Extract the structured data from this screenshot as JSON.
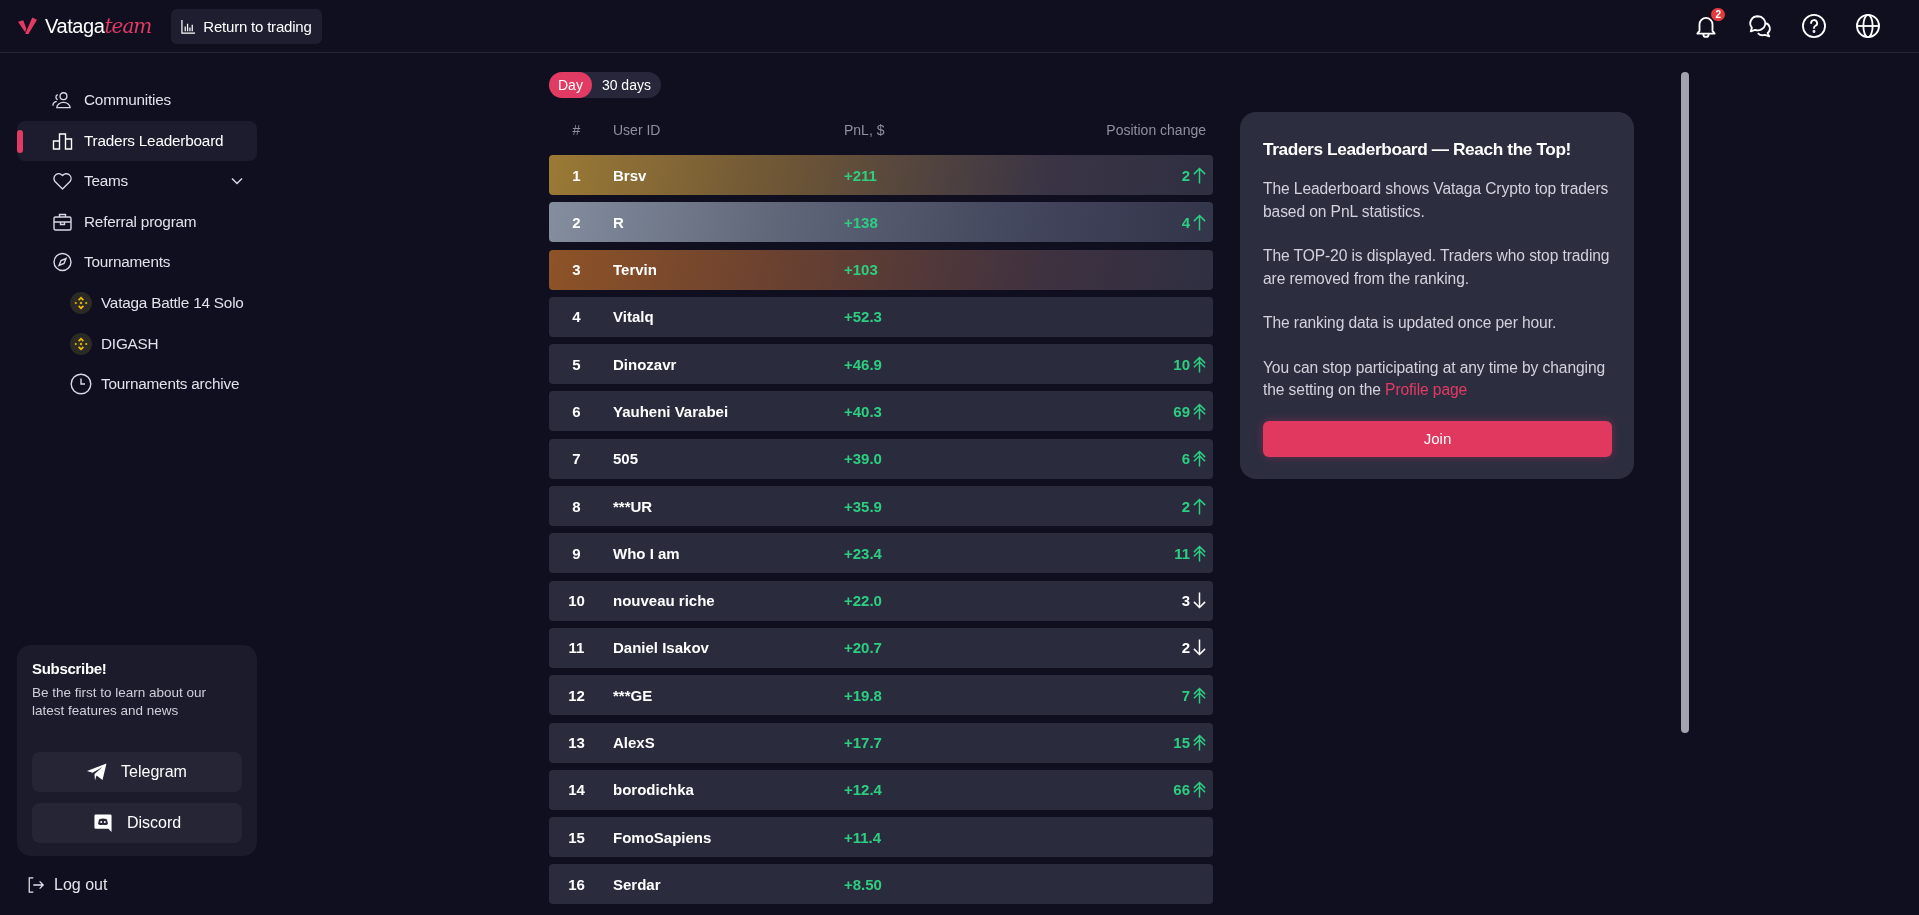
{
  "header": {
    "logo": {
      "name": "Vataga",
      "suffix": "team"
    },
    "return_button": "Return to trading",
    "notifications": {
      "count": "2"
    }
  },
  "sidebar": {
    "items": [
      {
        "label": "Communities",
        "kind": "link",
        "selected": false
      },
      {
        "label": "Traders Leaderboard",
        "kind": "link",
        "selected": true
      },
      {
        "label": "Teams",
        "kind": "dropdown",
        "selected": false,
        "expanded": false
      },
      {
        "label": "Referral program",
        "kind": "link",
        "selected": false
      },
      {
        "label": "Tournaments",
        "kind": "link",
        "selected": false,
        "children": [
          {
            "label": "Vataga Battle 14 Solo",
            "selected": false
          },
          {
            "label": "DIGASH",
            "selected": false
          },
          {
            "label": "Tournaments archive",
            "selected": false
          }
        ]
      }
    ],
    "subscribe": {
      "title": "Subscribe!",
      "text": "Be the first to learn about our latest features and news",
      "buttons": [
        "Telegram",
        "Discord"
      ]
    },
    "logout": "Log out"
  },
  "periods": [
    {
      "label": "Day",
      "selected": true
    },
    {
      "label": "30 days",
      "selected": false
    }
  ],
  "table": {
    "columns": [
      "#",
      "User ID",
      "PnL, $",
      "Position change"
    ],
    "rows": [
      {
        "rank": "1",
        "user": "Brsv",
        "pnl": "+211",
        "change": {
          "value": "2",
          "kind": "up"
        },
        "kind": "gold"
      },
      {
        "rank": "2",
        "user": "R",
        "pnl": "+138",
        "change": {
          "value": "4",
          "kind": "up"
        },
        "kind": "silver"
      },
      {
        "rank": "3",
        "user": "Tervin",
        "pnl": "+103",
        "kind": "bronze"
      },
      {
        "rank": "4",
        "user": "Vitalq",
        "pnl": "+52.3",
        "kind": "plain"
      },
      {
        "rank": "5",
        "user": "Dinozavr",
        "pnl": "+46.9",
        "change": {
          "value": "10",
          "kind": "surge"
        },
        "kind": "plain"
      },
      {
        "rank": "6",
        "user": "Yauheni Varabei",
        "pnl": "+40.3",
        "change": {
          "value": "69",
          "kind": "surge"
        },
        "kind": "plain"
      },
      {
        "rank": "7",
        "user": "505",
        "pnl": "+39.0",
        "change": {
          "value": "6",
          "kind": "surge"
        },
        "kind": "plain"
      },
      {
        "rank": "8",
        "user": "***UR",
        "pnl": "+35.9",
        "change": {
          "value": "2",
          "kind": "up"
        },
        "kind": "plain"
      },
      {
        "rank": "9",
        "user": "Who I am",
        "pnl": "+23.4",
        "change": {
          "value": "11",
          "kind": "surge"
        },
        "kind": "plain"
      },
      {
        "rank": "10",
        "user": "nouveau riche",
        "pnl": "+22.0",
        "change": {
          "value": "3",
          "kind": "down"
        },
        "kind": "plain"
      },
      {
        "rank": "11",
        "user": "Daniel Isakov",
        "pnl": "+20.7",
        "change": {
          "value": "2",
          "kind": "down"
        },
        "kind": "plain"
      },
      {
        "rank": "12",
        "user": "***GE",
        "pnl": "+19.8",
        "change": {
          "value": "7",
          "kind": "surge"
        },
        "kind": "plain"
      },
      {
        "rank": "13",
        "user": "AlexS",
        "pnl": "+17.7",
        "change": {
          "value": "15",
          "kind": "surge"
        },
        "kind": "plain"
      },
      {
        "rank": "14",
        "user": "borodichka",
        "pnl": "+12.4",
        "change": {
          "value": "66",
          "kind": "surge"
        },
        "kind": "plain"
      },
      {
        "rank": "15",
        "user": "FomoSapiens",
        "pnl": "+11.4",
        "kind": "plain"
      },
      {
        "rank": "16",
        "user": "Serdar",
        "pnl": "+8.50",
        "kind": "plain"
      }
    ]
  },
  "info_card": {
    "title": "Traders Leaderboard — Reach the Top!",
    "paragraphs": [
      "The Leaderboard shows Vataga Crypto top traders based on PnL statistics.",
      "The TOP-20 is displayed. Traders who stop trading are removed from the ranking.",
      "The ranking data is updated once per hour."
    ],
    "footer": {
      "text": "You can stop participating at any time by changing the setting on the",
      "link": "Profile page"
    },
    "button": "Join"
  }
}
